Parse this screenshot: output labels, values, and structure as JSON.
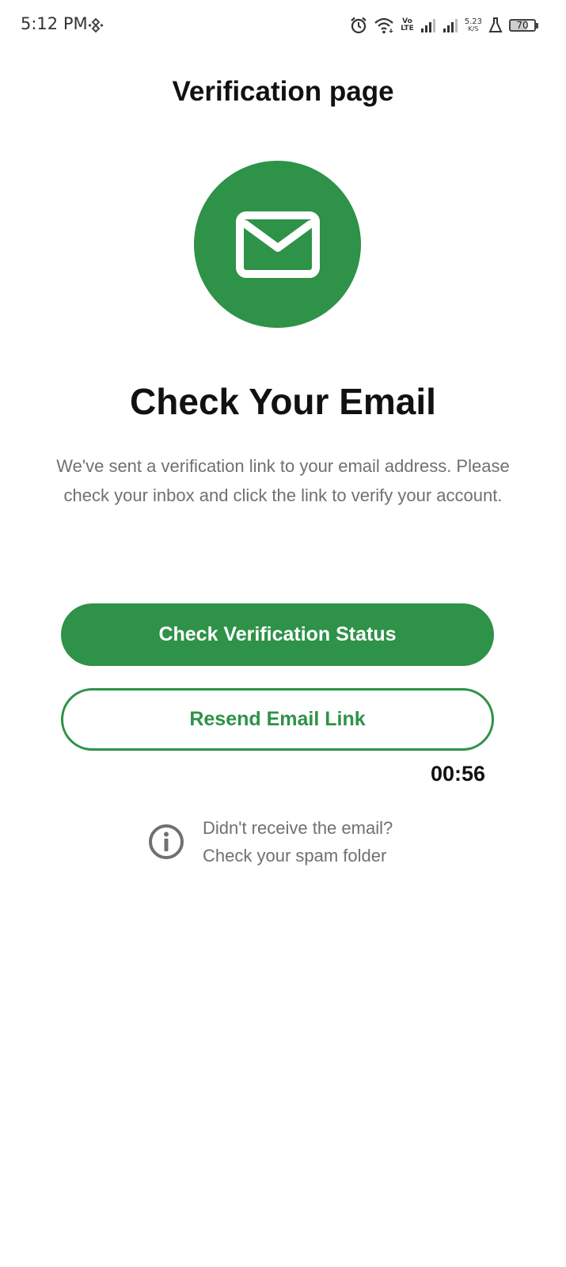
{
  "status_bar": {
    "time": "5:12 PM",
    "network_label_top": "Vo",
    "network_label_bottom": "LTE",
    "speed_value": "5.23",
    "speed_unit": "K/S",
    "battery_level": "70",
    "icons": [
      "binance-icon",
      "alarm-icon",
      "wifi-icon",
      "signal-icon",
      "signal-icon",
      "lab-flask-icon",
      "battery-icon"
    ]
  },
  "header": {
    "title": "Verification page"
  },
  "main": {
    "icon": "email-icon",
    "heading": "Check Your Email",
    "description": "We've sent a verification link to your email address. Please check your inbox and click the link to verify your account."
  },
  "actions": {
    "check_status_label": "Check Verification Status",
    "resend_label": "Resend Email Link",
    "timer": "00:56"
  },
  "hint": {
    "icon": "info-icon",
    "line1": "Didn't receive the email?",
    "line2": "Check your spam folder"
  },
  "colors": {
    "accent": "#2e9248",
    "muted_text": "#707070"
  }
}
